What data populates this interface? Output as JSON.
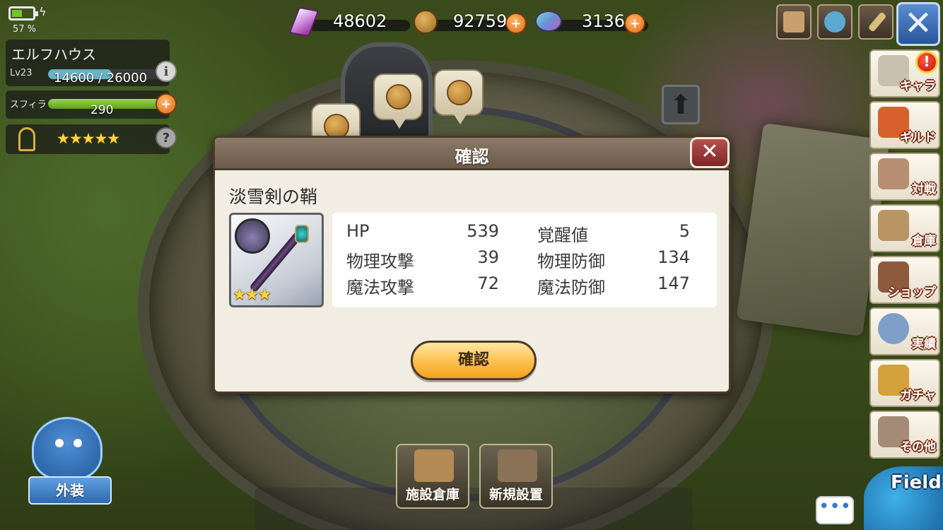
{
  "status": {
    "battery_percent": "57 %",
    "battery_level": 0.57
  },
  "house": {
    "name": "エルフハウス",
    "level": "Lv23",
    "xp_text": "14600 / 26000",
    "xp_progress": 0.56,
    "sphira_label": "スフィラ",
    "sphira_value": "290",
    "sphira_progress": 1.0,
    "rank_stars": "★★★★★"
  },
  "currency": {
    "gem": "48602",
    "gold": "92759",
    "crystal": "3136"
  },
  "side_menu": [
    {
      "label": "キャラ",
      "icon": "knight-icon"
    },
    {
      "label": "ギルド",
      "icon": "guild-banner-icon"
    },
    {
      "label": "対戦",
      "icon": "arena-icon"
    },
    {
      "label": "倉庫",
      "icon": "storage-box-icon"
    },
    {
      "label": "ショップ",
      "icon": "shop-icon"
    },
    {
      "label": "実績",
      "icon": "medal-icon"
    },
    {
      "label": "ガチャ",
      "icon": "treasure-chest-icon"
    },
    {
      "label": "その他",
      "icon": "book-icon"
    }
  ],
  "alert_mark": "!",
  "bottom": {
    "gaisou_label": "外装",
    "storage_label": "施設倉庫",
    "new_place_label": "新規設置",
    "field_label": "Field",
    "chat_dots": "•••"
  },
  "dialog": {
    "title": "確認",
    "close_symbol": "✕",
    "item_name": "淡雪剣の鞘",
    "item_stars": "★★★",
    "stats": [
      {
        "k1": "HP",
        "v1": "539",
        "k2": "覚醒値",
        "v2": "5"
      },
      {
        "k1": "物理攻撃",
        "v1": "39",
        "k2": "物理防御",
        "v2": "134"
      },
      {
        "k1": "魔法攻撃",
        "v1": "72",
        "k2": "魔法防御",
        "v2": "147"
      }
    ],
    "confirm_label": "確認"
  },
  "colors": {
    "dialog_bg": "#f2ede3",
    "dialog_header": "#7a6a58",
    "confirm_button": "#ffc65a",
    "xp_bar": "#6ab2c7",
    "sphira_bar": "#7cc232"
  }
}
